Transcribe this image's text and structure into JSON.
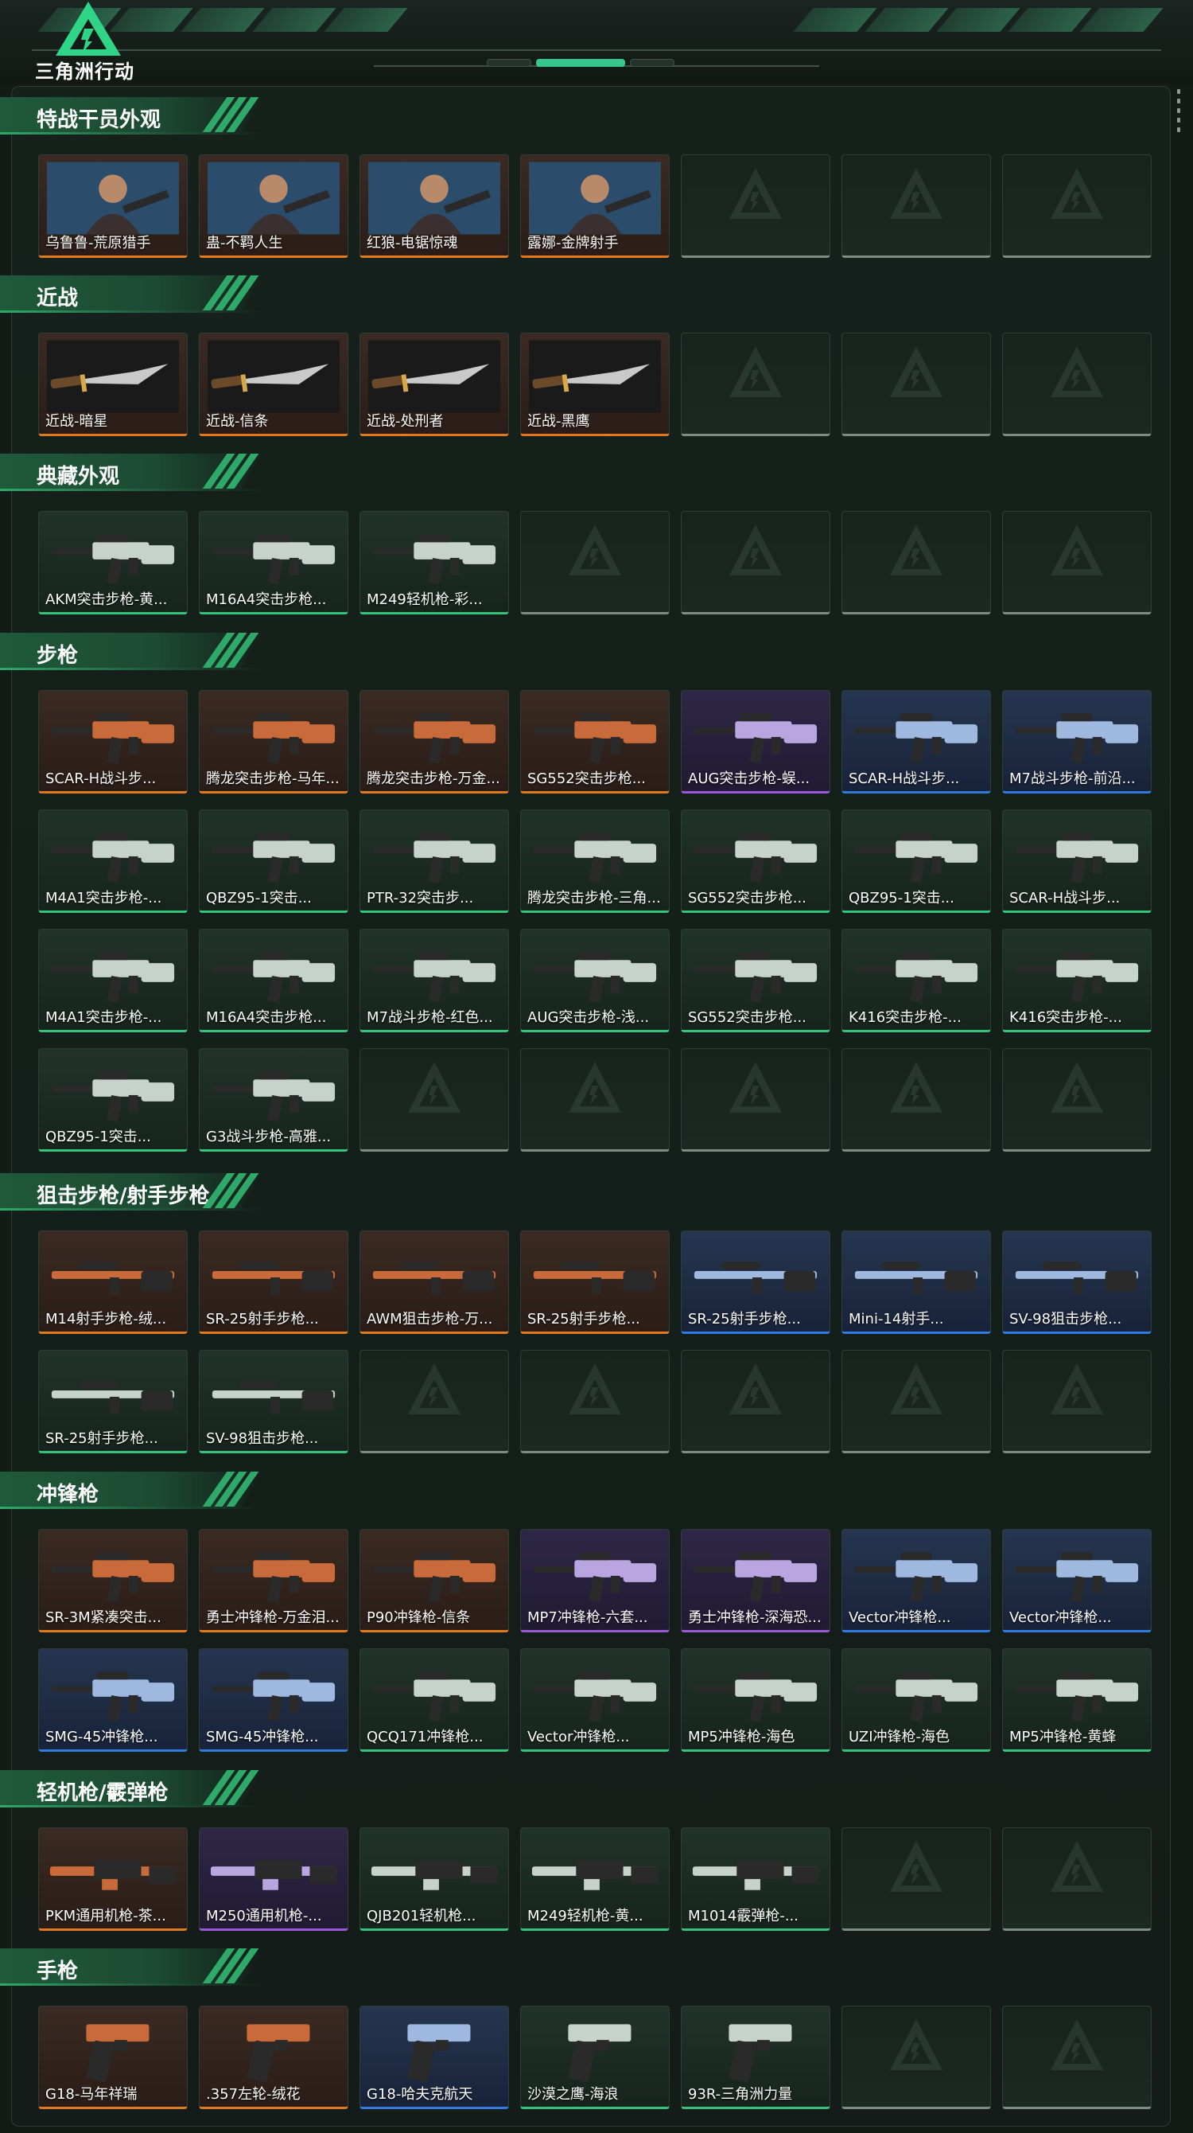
{
  "app": {
    "logo_text": "三角洲行动"
  },
  "page_indicator": {
    "count": 3,
    "active": 1
  },
  "colors": {
    "rarity_orange": "#e07a1e",
    "rarity_purple": "#9b59d6",
    "rarity_blue": "#2f7be0",
    "rarity_green": "#36c47b",
    "empty_slot": "#7e8a84",
    "accent": "#2fa968"
  },
  "sections": [
    {
      "title": "特战干员外观",
      "kind": "operator",
      "empty_slots": 3,
      "items": [
        {
          "name": "乌鲁鲁-荒原猎手",
          "rarity": "orange"
        },
        {
          "name": "蛊-不羁人生",
          "rarity": "orange"
        },
        {
          "name": "红狼-电锯惊魂",
          "rarity": "orange"
        },
        {
          "name": "露娜-金牌射手",
          "rarity": "orange"
        }
      ]
    },
    {
      "title": "近战",
      "kind": "knife",
      "empty_slots": 3,
      "items": [
        {
          "name": "近战-暗星",
          "rarity": "orange"
        },
        {
          "name": "近战-信条",
          "rarity": "orange"
        },
        {
          "name": "近战-处刑者",
          "rarity": "orange"
        },
        {
          "name": "近战-黑鹰",
          "rarity": "orange"
        }
      ]
    },
    {
      "title": "典藏外观",
      "kind": "rifle",
      "empty_slots": 4,
      "items": [
        {
          "name": "AKM突击步枪-黄...",
          "rarity": "green"
        },
        {
          "name": "M16A4突击步枪...",
          "rarity": "green"
        },
        {
          "name": "M249轻机枪-彩...",
          "rarity": "green"
        }
      ]
    },
    {
      "title": "步枪",
      "kind": "rifle",
      "empty_slots": 5,
      "items": [
        {
          "name": "SCAR-H战斗步...",
          "rarity": "orange"
        },
        {
          "name": "腾龙突击步枪-马年...",
          "rarity": "orange"
        },
        {
          "name": "腾龙突击步枪-万金...",
          "rarity": "orange"
        },
        {
          "name": "SG552突击步枪...",
          "rarity": "orange"
        },
        {
          "name": "AUG突击步枪-蜈...",
          "rarity": "purple"
        },
        {
          "name": "SCAR-H战斗步...",
          "rarity": "blue"
        },
        {
          "name": "M7战斗步枪-前沿...",
          "rarity": "blue"
        },
        {
          "name": "M4A1突击步枪-...",
          "rarity": "green"
        },
        {
          "name": "QBZ95-1突击...",
          "rarity": "green"
        },
        {
          "name": "PTR-32突击步...",
          "rarity": "green"
        },
        {
          "name": "腾龙突击步枪-三角...",
          "rarity": "green"
        },
        {
          "name": "SG552突击步枪...",
          "rarity": "green"
        },
        {
          "name": "QBZ95-1突击...",
          "rarity": "green"
        },
        {
          "name": "SCAR-H战斗步...",
          "rarity": "green"
        },
        {
          "name": "M4A1突击步枪-...",
          "rarity": "green"
        },
        {
          "name": "M16A4突击步枪...",
          "rarity": "green"
        },
        {
          "name": "M7战斗步枪-红色...",
          "rarity": "green"
        },
        {
          "name": "AUG突击步枪-浅...",
          "rarity": "green"
        },
        {
          "name": "SG552突击步枪...",
          "rarity": "green"
        },
        {
          "name": "K416突击步枪-...",
          "rarity": "green"
        },
        {
          "name": "K416突击步枪-...",
          "rarity": "green"
        },
        {
          "name": "QBZ95-1突击...",
          "rarity": "green"
        },
        {
          "name": "G3战斗步枪-高雅...",
          "rarity": "green"
        }
      ]
    },
    {
      "title": "狙击步枪/射手步枪",
      "kind": "sniper",
      "empty_slots": 5,
      "items": [
        {
          "name": "M14射手步枪-绒...",
          "rarity": "orange"
        },
        {
          "name": "SR-25射手步枪...",
          "rarity": "orange"
        },
        {
          "name": "AWM狙击步枪-万...",
          "rarity": "orange"
        },
        {
          "name": "SR-25射手步枪...",
          "rarity": "orange"
        },
        {
          "name": "SR-25射手步枪...",
          "rarity": "blue"
        },
        {
          "name": "Mini-14射手...",
          "rarity": "blue"
        },
        {
          "name": "SV-98狙击步枪...",
          "rarity": "blue"
        },
        {
          "name": "SR-25射手步枪...",
          "rarity": "green"
        },
        {
          "name": "SV-98狙击步枪...",
          "rarity": "green"
        }
      ]
    },
    {
      "title": "冲锋枪",
      "kind": "smg",
      "empty_slots": 0,
      "items": [
        {
          "name": "SR-3M紧凑突击...",
          "rarity": "orange"
        },
        {
          "name": "勇士冲锋枪-万金泪...",
          "rarity": "orange"
        },
        {
          "name": "P90冲锋枪-信条",
          "rarity": "orange"
        },
        {
          "name": "MP7冲锋枪-六套...",
          "rarity": "purple"
        },
        {
          "name": "勇士冲锋枪-深海恐...",
          "rarity": "purple"
        },
        {
          "name": "Vector冲锋枪...",
          "rarity": "blue"
        },
        {
          "name": "Vector冲锋枪...",
          "rarity": "blue"
        },
        {
          "name": "SMG-45冲锋枪...",
          "rarity": "blue"
        },
        {
          "name": "SMG-45冲锋枪...",
          "rarity": "blue"
        },
        {
          "name": "QCQ171冲锋枪...",
          "rarity": "green"
        },
        {
          "name": "Vector冲锋枪...",
          "rarity": "green"
        },
        {
          "name": "MP5冲锋枪-海色",
          "rarity": "green"
        },
        {
          "name": "UZI冲锋枪-海色",
          "rarity": "green"
        },
        {
          "name": "MP5冲锋枪-黄蜂",
          "rarity": "green"
        }
      ]
    },
    {
      "title": "轻机枪/霰弹枪",
      "kind": "lmg",
      "empty_slots": 2,
      "items": [
        {
          "name": "PKM通用机枪-茶...",
          "rarity": "orange"
        },
        {
          "name": "M250通用机枪-...",
          "rarity": "purple"
        },
        {
          "name": "QJB201轻机枪...",
          "rarity": "green"
        },
        {
          "name": "M249轻机枪-黄...",
          "rarity": "green"
        },
        {
          "name": "M1014霰弹枪-...",
          "rarity": "green"
        }
      ]
    },
    {
      "title": "手枪",
      "kind": "pistol",
      "empty_slots": 2,
      "items": [
        {
          "name": "G18-马年祥瑞",
          "rarity": "orange"
        },
        {
          "name": ".357左轮-绒花",
          "rarity": "orange"
        },
        {
          "name": "G18-哈夫克航天",
          "rarity": "blue"
        },
        {
          "name": "沙漠之鹰-海浪",
          "rarity": "green"
        },
        {
          "name": "93R-三角洲力量",
          "rarity": "green"
        }
      ]
    }
  ]
}
